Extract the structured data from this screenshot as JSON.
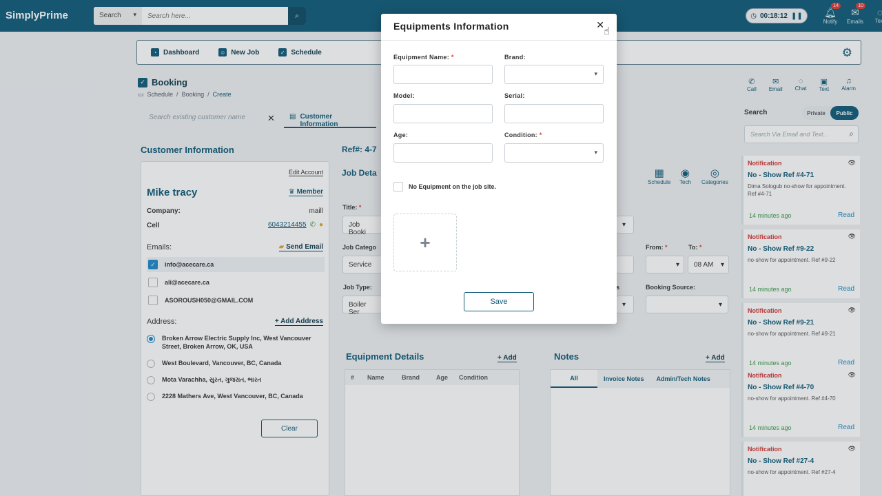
{
  "app": {
    "brand": "SimplyPrime"
  },
  "search": {
    "scope": "Search",
    "placeholder": "Search here..."
  },
  "timer": {
    "value": "00:18:12"
  },
  "top_icons": [
    {
      "label": "Notify",
      "badge": "14"
    },
    {
      "label": "Emails",
      "badge": "10"
    },
    {
      "label": "Text",
      "badge": ""
    }
  ],
  "nav": {
    "dashboard": "Dashboard",
    "new_job": "New Job",
    "schedule": "Schedule"
  },
  "booking": {
    "title": "Booking",
    "crumbs": [
      "Schedule",
      "/",
      "Booking",
      "/",
      "Create"
    ],
    "search_placeholder": "Search existing customer name",
    "tab_customer": "Customer Information"
  },
  "customer": {
    "section_title": "Customer Information",
    "edit_account": "Edit Account",
    "name": "Mike tracy",
    "member": "Member",
    "company_label": "Company:",
    "company_value": "maill",
    "cell_label": "Cell",
    "cell_value": "6043214455",
    "emails_label": "Emails:",
    "send_email": "Send Email",
    "emails": [
      "info@acecare.ca",
      "ali@acecare.ca",
      "ASOROUSH050@GMAIL.COM"
    ],
    "address_label": "Address:",
    "add_address": "+ Add Address",
    "addresses": [
      "Broken Arrow Electric Supply Inc, West Vancouver Street, Broken Arrow, OK, USA",
      "West Boulevard, Vancouver, BC, Canada",
      "Mota Varachha, સુરત, ગુજરાત, ભારત",
      "2228 Mathers Ave, West Vancouver, BC, Canada"
    ],
    "clear": "Clear"
  },
  "job": {
    "ref": "Ref#: 4-7",
    "details_title": "Job Deta",
    "title_label": "Title:",
    "title_value": "Job Booki",
    "category_label": "Job Catego",
    "category_value": "Service",
    "type_label": "Job Type:",
    "type_value": "Boiler Ser",
    "from_label": "From:",
    "to_label": "To:",
    "to_value": "08 AM",
    "booking_source_label": "Booking Source:",
    "partial_s": "s",
    "icons": {
      "schedule": "Schedule",
      "tech": "Tech",
      "categories": "Categories"
    }
  },
  "equipment": {
    "title": "Equipment Details",
    "add": "+ Add",
    "columns": [
      "#",
      "Name",
      "Brand",
      "Age",
      "Condition"
    ]
  },
  "notes": {
    "title": "Notes",
    "add": "+ Add",
    "tabs": [
      "All",
      "Invoice Notes",
      "Admin/Tech Notes"
    ]
  },
  "rpanel": {
    "comm": [
      "Call",
      "Email",
      "Chat",
      "Text",
      "Alarm"
    ],
    "search_label": "Search",
    "toggle": [
      "Private",
      "Public"
    ],
    "search_placeholder": "Search Via Email and Text...",
    "notifications": [
      {
        "type": "Notification",
        "title": "No - Show Ref #4-71",
        "body": "Dima Sologub no-show for appointment. Ref #4-71",
        "time": "14 minutes ago",
        "read": "Read"
      },
      {
        "type": "Notification",
        "title": "No - Show Ref #9-22",
        "body": "no-show for appointment. Ref #9-22",
        "time": "14 minutes ago",
        "read": "Read"
      },
      {
        "type": "Notification",
        "title": "No - Show Ref #9-21",
        "body": "no-show for appointment. Ref #9-21",
        "time": "14 minutes ago",
        "read": "Read"
      },
      {
        "type": "Notification",
        "title": "No - Show Ref #4-70",
        "body": "no-show for appointment. Ref #4-70",
        "time": "14 minutes ago",
        "read": "Read"
      },
      {
        "type": "Notification",
        "title": "No - Show Ref #27-4",
        "body": "no-show for appointment. Ref #27-4",
        "time": "",
        "read": ""
      }
    ]
  },
  "modal": {
    "title": "Equipments Information",
    "close": "✕",
    "equipment_name": "Equipment Name:",
    "brand": "Brand:",
    "model": "Model:",
    "serial": "Serial:",
    "age": "Age:",
    "condition": "Condition:",
    "required_mark": "*",
    "no_equipment": "No Equipment on the job site.",
    "upload_plus": "+",
    "save": "Save"
  },
  "colors": {
    "primary": "#0e5a78",
    "danger": "#d32f2f",
    "success": "#3a9b4a",
    "link": "#1e88c8"
  }
}
